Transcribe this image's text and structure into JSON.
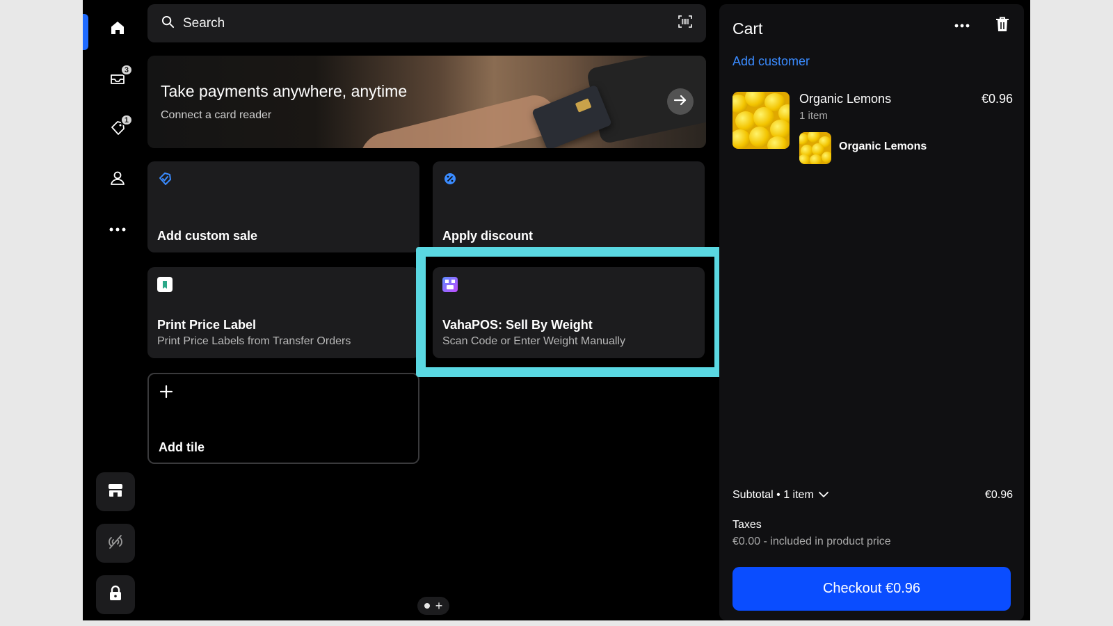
{
  "search": {
    "placeholder": "Search"
  },
  "sidebar": {
    "items": [
      {
        "icon": "home-icon"
      },
      {
        "icon": "inbox-icon",
        "badge": "3"
      },
      {
        "icon": "tag-icon",
        "badge": "1"
      },
      {
        "icon": "person-icon"
      },
      {
        "icon": "more-icon"
      }
    ],
    "bottom_buttons": [
      "store-icon",
      "no-connection-icon",
      "lock-icon"
    ]
  },
  "banner": {
    "title": "Take payments anywhere, anytime",
    "subtitle": "Connect a card reader"
  },
  "tiles": [
    {
      "title": "Add custom sale",
      "subtitle": "",
      "icon": "custom-sale-icon"
    },
    {
      "title": "Apply discount",
      "subtitle": "",
      "icon": "discount-icon"
    },
    {
      "title": "Print Price Label",
      "subtitle": "Print Price Labels from Transfer Orders",
      "icon": "print-label-app-icon"
    },
    {
      "title": "VahaPOS: Sell By Weight",
      "subtitle": "Scan Code or Enter Weight Manually",
      "icon": "vahapos-app-icon"
    },
    {
      "title": "Add tile",
      "subtitle": "",
      "icon": "plus-icon"
    }
  ],
  "cart": {
    "title": "Cart",
    "add_customer": "Add customer",
    "items": [
      {
        "name": "Organic Lemons",
        "quantity": "1 item",
        "price": "€0.96",
        "modifier": "Organic Lemons"
      }
    ],
    "subtotal_label": "Subtotal • 1 item",
    "subtotal_value": "€0.96",
    "taxes_label": "Taxes",
    "taxes_detail": "€0.00 - included in product price",
    "checkout_label": "Checkout €0.96"
  },
  "colors": {
    "accent": "#0a4dff",
    "link": "#3a8bff",
    "highlight": "#5ad8e2"
  }
}
